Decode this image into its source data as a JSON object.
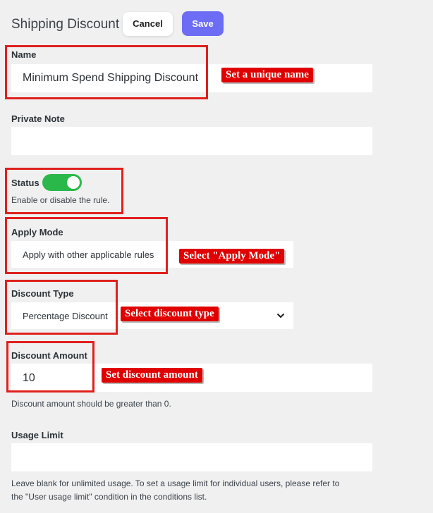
{
  "header": {
    "title": "Shipping Discount",
    "cancel_label": "Cancel",
    "save_label": "Save"
  },
  "name": {
    "label": "Name",
    "value": "Minimum Spend Shipping Discount",
    "annotation": "Set a unique name"
  },
  "private_note": {
    "label": "Private Note",
    "value": ""
  },
  "status": {
    "label": "Status",
    "enabled": true,
    "help": "Enable or disable the rule."
  },
  "apply_mode": {
    "label": "Apply Mode",
    "value": "Apply with other applicable rules",
    "annotation": "Select \"Apply Mode\""
  },
  "discount_type": {
    "label": "Discount Type",
    "value": "Percentage Discount",
    "annotation": "Select discount type",
    "icon": "chevron-down-icon"
  },
  "discount_amount": {
    "label": "Discount Amount",
    "value": "10",
    "annotation": "Set discount amount",
    "help": "Discount amount should be greater than 0."
  },
  "usage_limit": {
    "label": "Usage Limit",
    "value": "",
    "help_line1": "Leave blank for unlimited usage. To set a usage limit for individual users, please refer to",
    "help_line2": "the \"User usage limit\" condition in the conditions list."
  },
  "colors": {
    "accent": "#6c6cf5",
    "toggle_on": "#2bb84a",
    "highlight": "#e0201c"
  }
}
